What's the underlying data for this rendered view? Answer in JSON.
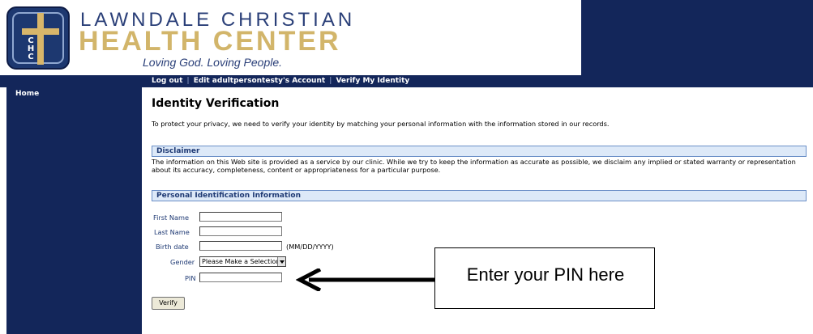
{
  "header": {
    "logo_letters": [
      "C",
      "H",
      "C"
    ],
    "org_name_line1": "LAWNDALE CHRISTIAN",
    "org_name_line2": "HEALTH CENTER",
    "tagline": "Loving God. Loving People."
  },
  "topnav": {
    "items": [
      "Log out",
      "Edit adultpersontesty's Account",
      "Verify My Identity"
    ]
  },
  "sidebar": {
    "items": [
      "Home"
    ]
  },
  "main": {
    "title": "Identity Verification",
    "intro": "To protect your privacy, we need to verify your identity by matching your personal information with the information stored in our records.",
    "disclaimer_heading": "Disclaimer",
    "disclaimer_text": "The information on this Web site is provided as a service by our clinic. While we try to keep the information as accurate as possible, we disclaim any implied or stated warranty or representation about its accuracy, completeness, content or appropriateness for a particular purpose.",
    "pii_heading": "Personal Identification Information",
    "form": {
      "first_name_label": "First Name",
      "first_name_value": "",
      "last_name_label": "Last Name",
      "last_name_value": "",
      "birth_date_label": "Birth date",
      "birth_date_value": "",
      "birth_date_hint": "(MM/DD/YYYY)",
      "gender_label": "Gender",
      "gender_selected": "Please Make a Selection",
      "pin_label": "PIN",
      "pin_value": "",
      "verify_label": "Verify"
    }
  },
  "annotation": {
    "callout_text": "Enter your PIN here"
  },
  "colors": {
    "navy": "#13265a",
    "gold": "#d2b56a",
    "section_bg": "#dde9f8",
    "section_border": "#6b8fc7",
    "label_text": "#1f3a74"
  }
}
